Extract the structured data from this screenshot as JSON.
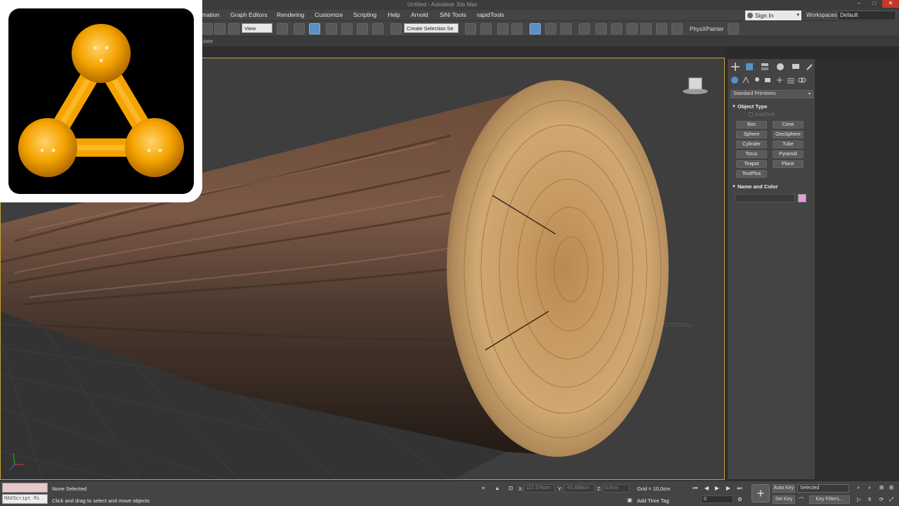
{
  "titlebar": {
    "title": "Untitled - Autodesk 3ds Max"
  },
  "menubar": {
    "items": [
      "mation",
      "Graph Editors",
      "Rendering",
      "Customize",
      "Scripting",
      "Help",
      "Arnold",
      "SiNi Tools",
      "rapidTools"
    ],
    "sign_in": "Sign In",
    "workspaces_label": "Workspaces:",
    "workspace_value": "Default"
  },
  "toolbar": {
    "view_select": "View",
    "selection_set": "Create Selection Se",
    "physx": "PhysXPainter"
  },
  "subbar": {
    "text": "ulate"
  },
  "command_panel": {
    "category": "Standard Primitives",
    "object_type_title": "Object Type",
    "autogrid": "AutoGrid",
    "primitives": [
      "Box",
      "Cone",
      "Sphere",
      "GeoSphere",
      "Cylinder",
      "Tube",
      "Torus",
      "Pyramid",
      "Teapot",
      "Plane",
      "TextPlus"
    ],
    "name_color_title": "Name and Color",
    "swatch_color": "#e59bdc"
  },
  "status": {
    "maxscript": "MAXScript Mi",
    "selection": "None Selected",
    "prompt": "Click and drag to select and move objects",
    "x_label": "X:",
    "x_value": "117,378cm",
    "y_label": "Y:",
    "y_value": "-51,658cm",
    "z_label": "Z:",
    "z_value": "0,0cm",
    "grid": "Grid = 10,0cm",
    "add_time_tag": "Add Time Tag",
    "frame": "0",
    "auto_key": "Auto Key",
    "set_key": "Set Key",
    "selected": "Selected",
    "key_filters": "Key Filters..."
  },
  "colors": {
    "logo_orange": "#f5a300",
    "viewport_border": "#c6a53a",
    "active_button": "#5a8fc7"
  }
}
